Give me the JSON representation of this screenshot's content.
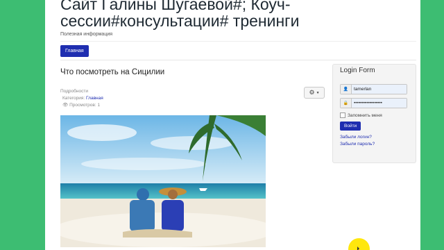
{
  "site": {
    "title": "Сайт Галины Шугаевой#; Коуч-сессии#консультации# тренинги",
    "description": "Полезная информация"
  },
  "nav": {
    "home": "Главная"
  },
  "article": {
    "title": "Что посмотреть на Сицилии",
    "details_label": "Подробности",
    "category_label": "Категория:",
    "category_link": "Главная",
    "views_text": "Просмотров: 1"
  },
  "login": {
    "heading": "Login Form",
    "username_value": "tamerlan",
    "password_value": "••••••••••••••••••",
    "remember_label": "Запомнить меня",
    "submit_label": "Войти",
    "forgot_login": "Забыли логин?",
    "forgot_password": "Забыли пароль?"
  },
  "icons": {
    "gear": "gear-icon",
    "user": "user-icon",
    "lock": "lock-icon",
    "eye": "eye-icon"
  },
  "colors": {
    "background": "#3dbd72",
    "accent": "#1f2eb0",
    "cursor_highlight": "#ffe600"
  }
}
